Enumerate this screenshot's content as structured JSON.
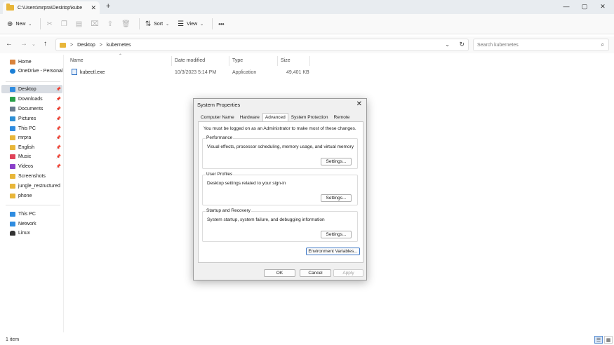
{
  "tab": {
    "title": "C:\\Users\\mrpra\\Desktop\\kube"
  },
  "window_controls": {
    "minimize": "—",
    "maximize": "▢",
    "close": "✕",
    "new_tab": "+",
    "tab_close": "✕"
  },
  "toolbar": {
    "new_label": "New",
    "sort_label": "Sort",
    "view_label": "View",
    "more_label": "•••"
  },
  "address": {
    "crumbs": [
      "Desktop",
      "kubernetes"
    ],
    "separator": ">"
  },
  "search": {
    "placeholder": "Search kubernetes"
  },
  "sidebar": {
    "items": [
      {
        "label": "Home",
        "icon": "home-icon",
        "color": "#d9823b"
      },
      {
        "label": "OneDrive - Personal",
        "icon": "cloud-icon",
        "color": "#1b7fd6"
      },
      {
        "label": "Desktop",
        "icon": "desktop-icon",
        "color": "#2f8ce0",
        "pinned": true
      },
      {
        "label": "Downloads",
        "icon": "download-icon",
        "color": "#2aa04a",
        "pinned": true
      },
      {
        "label": "Documents",
        "icon": "document-icon",
        "color": "#6b7c8f",
        "pinned": true
      },
      {
        "label": "Pictures",
        "icon": "picture-icon",
        "color": "#2d8fd5",
        "pinned": true
      },
      {
        "label": "This PC",
        "icon": "pc-icon",
        "color": "#2f8ce0",
        "pinned": true
      },
      {
        "label": "mrpra",
        "icon": "folder-icon",
        "color": "#e8b63a",
        "pinned": true
      },
      {
        "label": "English",
        "icon": "folder-icon",
        "color": "#e8b63a",
        "pinned": true
      },
      {
        "label": "Music",
        "icon": "music-icon",
        "color": "#e0435a",
        "pinned": true
      },
      {
        "label": "Videos",
        "icon": "video-icon",
        "color": "#8a3fc9",
        "pinned": true
      },
      {
        "label": "Screenshots",
        "icon": "folder-icon",
        "color": "#e8b63a"
      },
      {
        "label": "jungle_restructured",
        "icon": "folder-icon",
        "color": "#e8b63a"
      },
      {
        "label": "phone",
        "icon": "folder-icon",
        "color": "#e8b63a"
      },
      {
        "label": "This PC",
        "icon": "pc-icon",
        "color": "#2f8ce0"
      },
      {
        "label": "Network",
        "icon": "network-icon",
        "color": "#2f8ce0"
      },
      {
        "label": "Linux",
        "icon": "linux-icon",
        "color": "#333333"
      }
    ]
  },
  "columns": [
    "Name",
    "Date modified",
    "Type",
    "Size"
  ],
  "files": [
    {
      "name": "kubectl.exe",
      "date": "10/3/2023 5:14 PM",
      "type": "Application",
      "size": "49,401 KB"
    }
  ],
  "status": {
    "count": "1 item"
  },
  "dialog": {
    "title": "System Properties",
    "tabs": [
      "Computer Name",
      "Hardware",
      "Advanced",
      "System Protection",
      "Remote"
    ],
    "active_tab": "Advanced",
    "note": "You must be logged on as an Administrator to make most of these changes.",
    "groups": [
      {
        "title": "Performance",
        "desc": "Visual effects, processor scheduling, memory usage, and virtual memory",
        "button": "Settings..."
      },
      {
        "title": "User Profiles",
        "desc": "Desktop settings related to your sign-in",
        "button": "Settings..."
      },
      {
        "title": "Startup and Recovery",
        "desc": "System startup, system failure, and debugging information",
        "button": "Settings..."
      }
    ],
    "env_button": "Environment Variables...",
    "ok": "OK",
    "cancel": "Cancel",
    "apply": "Apply"
  }
}
